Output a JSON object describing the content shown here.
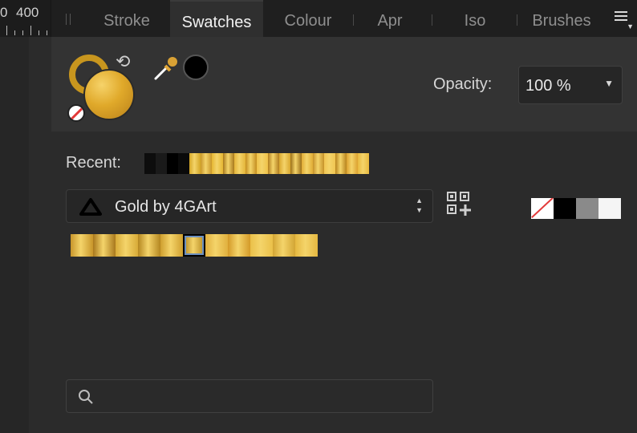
{
  "ruler": {
    "label_left": "0",
    "label_right": "400"
  },
  "tabs": [
    {
      "label": "Stroke",
      "active": false
    },
    {
      "label": "Swatches",
      "active": true
    },
    {
      "label": "Colour",
      "active": false
    },
    {
      "label": "Apr",
      "active": false
    },
    {
      "label": "Iso",
      "active": false
    },
    {
      "label": "Brushes",
      "active": false
    }
  ],
  "icons": {
    "menu": "hamburger-menu-icon",
    "swap": "swap-colours-icon",
    "dropper": "eyedropper-icon",
    "none": "no-fill-icon",
    "palette": "affinity-logo-icon",
    "add": "add-swatch-grid-icon",
    "search": "search-icon"
  },
  "colour_panel": {
    "fill_color": "#e0a92a",
    "stroke_color": "#c8961e",
    "picker_color": "#000000"
  },
  "opacity": {
    "label": "Opacity:",
    "value": "100 %"
  },
  "recent": {
    "label": "Recent:",
    "swatches": [
      "#0d0d0d",
      "#1a1a1a",
      "#000000",
      "#0a0a0a",
      "#d4a626",
      "#c9972a",
      "#e6b733",
      "#a8791c",
      "#e4b53a",
      "#c48e20",
      "#efc24a",
      "#b27e1f",
      "#d9a72f",
      "#9c7019",
      "#e1ad36",
      "#c6922a",
      "#f0c552",
      "#b8851e",
      "#dca230",
      "#e8b93e"
    ]
  },
  "palette": {
    "name": "Gold by 4GArt",
    "swatches": [
      "#c8952a",
      "#a9781d",
      "#d8ab38",
      "#b48620",
      "#cf9f2e",
      "#b88c24",
      "#e1b03e",
      "#d49a28",
      "#eac049",
      "#d3a534",
      "#e5b841"
    ],
    "selected_index": 5
  },
  "mini_swatches": [
    "none",
    "#000000",
    "#8a8a8a",
    "#f5f5f5"
  ],
  "search": {
    "placeholder": ""
  }
}
